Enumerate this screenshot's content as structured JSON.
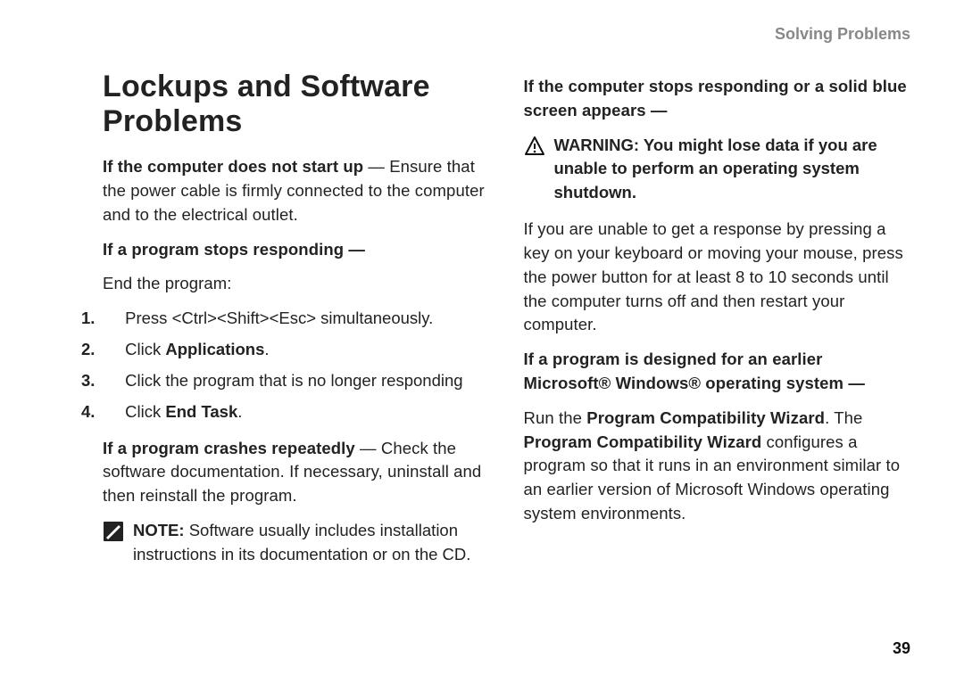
{
  "runningHeader": "Solving Problems",
  "pageNumber": "39",
  "title": "Lockups and Software Problems",
  "leftCol": {
    "p1_bold": "If the computer does not start up",
    "p1_dash": " — ",
    "p1_rest": "Ensure that the power cable is firmly connected to the computer and to the electrical outlet.",
    "p2_bold": "If a program stops responding —",
    "p3": "End the program:",
    "steps": {
      "s1": {
        "num": "1.",
        "text": "Press <Ctrl><Shift><Esc> simultaneously."
      },
      "s2": {
        "num": "2.",
        "pre": "Click ",
        "bold": "Applications",
        "post": "."
      },
      "s3": {
        "num": "3.",
        "text": "Click the program that is no longer responding"
      },
      "s4": {
        "num": "4.",
        "pre": "Click ",
        "bold": "End Task",
        "post": "."
      }
    },
    "p4_bold": "If a program crashes repeatedly",
    "p4_dash": " — ",
    "p4_rest": "Check the software documentation. If necessary, uninstall and then reinstall the program.",
    "note_label": "NOTE:",
    "note_text": " Software usually includes installation instructions in its documentation or on the CD."
  },
  "rightCol": {
    "p1_bold": "If the computer stops responding or a solid blue screen appears —",
    "warn_label": "WARNING: You might lose data if you are unable to perform an operating system shutdown.",
    "p2": "If you are unable to get a response by pressing a key on your keyboard or moving your mouse, press the power button for at least 8 to 10 seconds until the computer turns off and then restart your computer.",
    "p3_bold": "If a program is designed for an earlier Microsoft® Windows® operating system —",
    "p4_pre": "Run the ",
    "p4_b1": "Program Compatibility Wizard",
    "p4_mid": ". The ",
    "p4_b2": "Program Compatibility Wizard",
    "p4_rest": " configures a program so that it runs in an environment similar to an earlier version of Microsoft Windows operating system environments."
  }
}
